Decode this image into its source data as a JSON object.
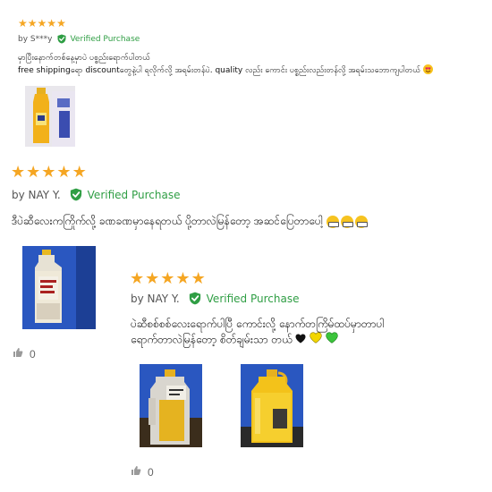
{
  "reviews": [
    {
      "rating": 5,
      "byline": "by S***y",
      "verified_label": "Verified Purchase",
      "text_lines": [
        "မှာပြီးနောက်တစ်နေ့မှာပဲ ပစ္စည်းရောက်ပါတယ်",
        "free shippingရော discountတွေနဲ့ပါ ရလိုက်လို့ အရမ်းတန်ပဲ. quality လည်း ကောင်း ပစ္စည်းလည်းတန်လို့ အရမ်းသဘောကျပါတယ်"
      ]
    },
    {
      "rating": 5,
      "byline": "by NAY Y.",
      "verified_label": "Verified Purchase",
      "text_lines": [
        "ဒီပဲဆီလေးကကြိုက်လို့ ခဏခဏမှာနေရတယ် ပို့တာလဲမြန်တော့ အဆင်ပြေတာပေါ့"
      ],
      "likes": "0"
    },
    {
      "rating": 5,
      "byline": "by NAY Y.",
      "verified_label": "Verified Purchase",
      "text_lines": [
        "ပဲဆီစစ်စစ်လေးရောက်ပါပြီ ကောင်းလို့ နောက်တကြိမ်ထပ်မှာတာပါ",
        "ရောက်တာလဲမြန်တော့ စိတ်ချမ်းသာ တယ်"
      ],
      "likes": "0"
    }
  ],
  "colors": {
    "star": "#f5a623",
    "verified": "#2f9e44",
    "heart_black": "#111111",
    "heart_yellow": "#f2d600",
    "heart_green": "#3cc43c"
  }
}
